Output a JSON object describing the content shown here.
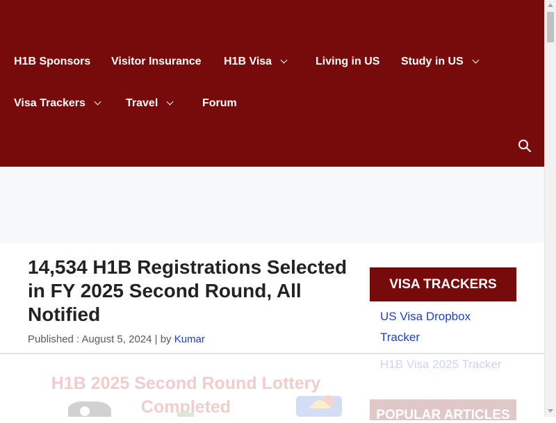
{
  "nav": {
    "items": [
      {
        "label": "H1B Sponsors",
        "has_dropdown": false
      },
      {
        "label": "Visitor Insurance",
        "has_dropdown": false
      },
      {
        "label": "H1B Visa",
        "has_dropdown": true
      },
      {
        "label": "Living in US",
        "has_dropdown": false
      },
      {
        "label": "Study in US",
        "has_dropdown": true
      },
      {
        "label": "Visa Trackers",
        "has_dropdown": true
      },
      {
        "label": "Travel",
        "has_dropdown": true
      },
      {
        "label": "Forum",
        "has_dropdown": false
      }
    ],
    "search_icon": "search-icon"
  },
  "article": {
    "title": "14,534 H1B Registrations Selected in FY 2025 Second Round, All Notified",
    "published_prefix": "Published : August 5, 2024 | by ",
    "author": "Kumar",
    "featured_image_title": "H1B 2025 Second Round Lottery Completed"
  },
  "sidebar": {
    "widget_title": "VISA TRACKERS",
    "links": [
      "US Visa Dropbox Tracker",
      "H1B Visa 2025 Tracker"
    ],
    "popular_title": "POPULAR ARTICLES"
  },
  "colors": {
    "header_bg": "#770b0b",
    "link": "#1e40c8",
    "ad_band": "#f7f8f9"
  }
}
